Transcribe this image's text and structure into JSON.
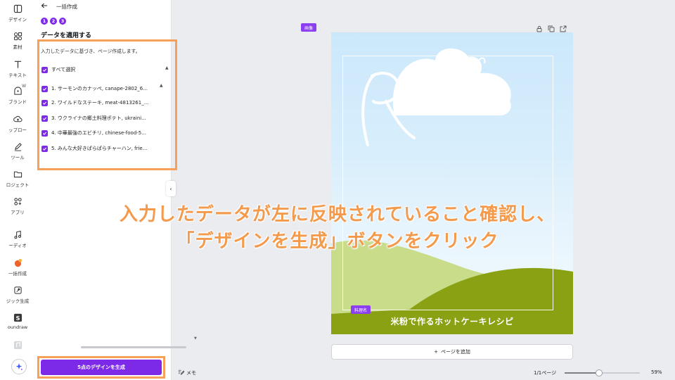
{
  "rail": {
    "items": [
      {
        "label": "デザイン",
        "icon": "design-icon"
      },
      {
        "label": "素材",
        "icon": "elements-icon"
      },
      {
        "label": "テキスト",
        "icon": "text-icon"
      },
      {
        "label": "ブランド",
        "icon": "brand-icon"
      },
      {
        "label": "ップロー",
        "icon": "upload-icon"
      },
      {
        "label": "ツール",
        "icon": "draw-icon"
      },
      {
        "label": "ロジェクト",
        "icon": "folder-icon"
      },
      {
        "label": "アプリ",
        "icon": "apps-icon"
      },
      {
        "label": "ーディオ",
        "icon": "audio-icon"
      },
      {
        "label": "一括作成",
        "icon": "bulk-create-icon"
      },
      {
        "label": "ジック生成",
        "icon": "magic-media-icon"
      },
      {
        "label": "oundraw",
        "icon": "soundraw-icon"
      }
    ],
    "brand_badge": "W"
  },
  "panel": {
    "back_label": "一括作成",
    "steps": [
      "1",
      "2",
      "3"
    ],
    "title": "データを適用する",
    "description": "入力したデータに基づき、ページ作成します。",
    "select_all": "すべて選択",
    "rows": [
      "1. サーモンのカナッペ, canape-2802_6...",
      "2. ワイルドなステーキ, meat-4813261_...",
      "3. ウクライナの郷土料理ポテト, ukraini...",
      "4. 中華最強のエビチリ, chinese-food-5...",
      "5. みんな大好きぱらぱらチャーハン, frie..."
    ],
    "generate_button": "5点のデザインを生成"
  },
  "canvas": {
    "image_tag": "画像",
    "cook_tag": "料理名",
    "recipe_title": "米粉で作るホットケーキレシピ",
    "add_page": "ページを追加",
    "add_page_icon": "+"
  },
  "overlay": {
    "line1": "入力したデータが左に反映されていること確認し、",
    "line2": "「デザインを生成」ボタンをクリック"
  },
  "bottom": {
    "memo": "メモ",
    "page_count": "1/1ページ",
    "zoom": "59%",
    "zoom_fraction": 0.46
  },
  "colors": {
    "accent": "#7d2ae8",
    "annotation": "#f39a4d"
  }
}
